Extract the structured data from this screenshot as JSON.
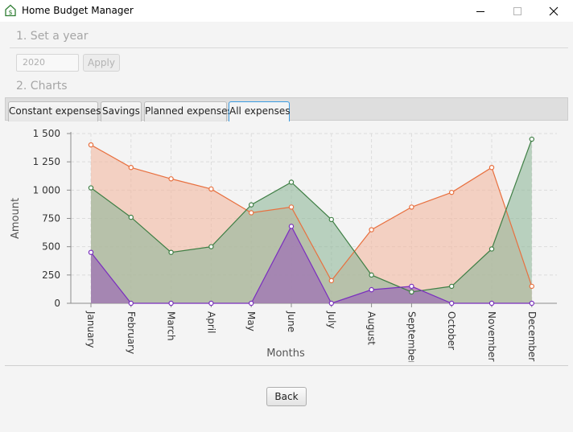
{
  "window": {
    "title": "Home Budget Manager",
    "icon": "money-house-icon"
  },
  "section1": {
    "title": "1. Set a year"
  },
  "year_field": {
    "value": "2020"
  },
  "apply_button": {
    "label": "Apply"
  },
  "section2": {
    "title": "2. Charts"
  },
  "tabs": [
    {
      "label": "Constant expenses"
    },
    {
      "label": "Savings"
    },
    {
      "label": "Planned expenses"
    },
    {
      "label": "All expenses",
      "selected": true
    }
  ],
  "back_button": {
    "label": "Back"
  },
  "chart_data": {
    "type": "area",
    "xlabel": "Months",
    "ylabel": "Amount",
    "ylim": [
      0,
      1500
    ],
    "yticks": [
      0,
      250,
      500,
      750,
      1000,
      1250,
      1500
    ],
    "ytick_labels": [
      "0",
      "250",
      "500",
      "750",
      "1 000",
      "1 250",
      "1 500"
    ],
    "grid": true,
    "legend": "none",
    "categories": [
      "January",
      "February",
      "March",
      "April",
      "May",
      "June",
      "July",
      "August",
      "September",
      "October",
      "November",
      "December"
    ],
    "series": [
      {
        "color": "#e8703f",
        "fill": "#f2b8a0",
        "values": [
          1400,
          1200,
          1100,
          1010,
          800,
          850,
          200,
          650,
          850,
          980,
          1200,
          150
        ]
      },
      {
        "color": "#3f7f45",
        "fill": "#8fb89a",
        "values": [
          1020,
          760,
          450,
          500,
          870,
          1070,
          740,
          250,
          100,
          150,
          480,
          1450
        ]
      },
      {
        "color": "#7a2fbe",
        "fill": "#9a5fb8",
        "values": [
          450,
          0,
          0,
          0,
          0,
          680,
          0,
          120,
          150,
          0,
          0,
          0
        ]
      }
    ]
  }
}
